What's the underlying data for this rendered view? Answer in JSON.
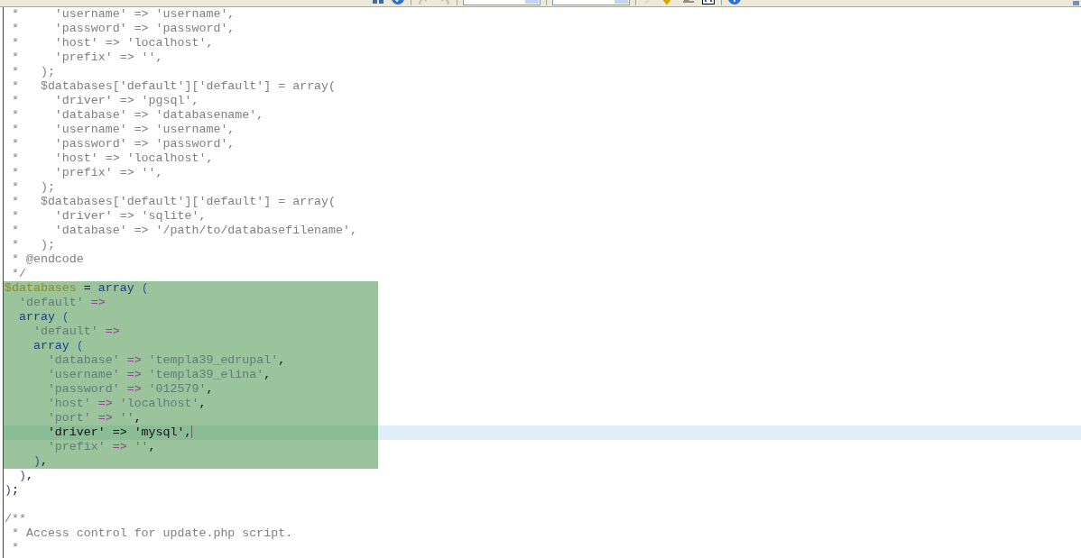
{
  "toolbar": {
    "items": [
      {
        "kind": "grid",
        "disabled": false
      },
      {
        "kind": "help",
        "disabled": false
      },
      {
        "kind": "sep"
      },
      {
        "kind": "redo",
        "disabled": true
      },
      {
        "kind": "undo",
        "disabled": true
      },
      {
        "kind": "sep"
      },
      {
        "kind": "dropdown"
      },
      {
        "kind": "sep"
      },
      {
        "kind": "dropdown"
      },
      {
        "kind": "sep"
      },
      {
        "kind": "pen",
        "disabled": true
      },
      {
        "kind": "check",
        "disabled": false
      },
      {
        "kind": "eraser",
        "disabled": false
      },
      {
        "kind": "swap",
        "disabled": false
      },
      {
        "kind": "sep"
      },
      {
        "kind": "info",
        "disabled": false
      }
    ]
  },
  "lines": [
    {
      "selected": false,
      "current": false,
      "caret": false,
      "tokens": [
        {
          "kind": "comment",
          "text": " *     'username' => 'username',"
        }
      ]
    },
    {
      "selected": false,
      "current": false,
      "caret": false,
      "tokens": [
        {
          "kind": "comment",
          "text": " *     'password' => 'password',"
        }
      ]
    },
    {
      "selected": false,
      "current": false,
      "caret": false,
      "tokens": [
        {
          "kind": "comment",
          "text": " *     'host' => 'localhost',"
        }
      ]
    },
    {
      "selected": false,
      "current": false,
      "caret": false,
      "tokens": [
        {
          "kind": "comment",
          "text": " *     'prefix' => '',"
        }
      ]
    },
    {
      "selected": false,
      "current": false,
      "caret": false,
      "tokens": [
        {
          "kind": "comment",
          "text": " *   );"
        }
      ]
    },
    {
      "selected": false,
      "current": false,
      "caret": false,
      "tokens": [
        {
          "kind": "comment",
          "text": " *   $databases['default']['default'] = array("
        }
      ]
    },
    {
      "selected": false,
      "current": false,
      "caret": false,
      "tokens": [
        {
          "kind": "comment",
          "text": " *     'driver' => 'pgsql',"
        }
      ]
    },
    {
      "selected": false,
      "current": false,
      "caret": false,
      "tokens": [
        {
          "kind": "comment",
          "text": " *     'database' => 'databasename',"
        }
      ]
    },
    {
      "selected": false,
      "current": false,
      "caret": false,
      "tokens": [
        {
          "kind": "comment",
          "text": " *     'username' => 'username',"
        }
      ]
    },
    {
      "selected": false,
      "current": false,
      "caret": false,
      "tokens": [
        {
          "kind": "comment",
          "text": " *     'password' => 'password',"
        }
      ]
    },
    {
      "selected": false,
      "current": false,
      "caret": false,
      "tokens": [
        {
          "kind": "comment",
          "text": " *     'host' => 'localhost',"
        }
      ]
    },
    {
      "selected": false,
      "current": false,
      "caret": false,
      "tokens": [
        {
          "kind": "comment",
          "text": " *     'prefix' => '',"
        }
      ]
    },
    {
      "selected": false,
      "current": false,
      "caret": false,
      "tokens": [
        {
          "kind": "comment",
          "text": " *   );"
        }
      ]
    },
    {
      "selected": false,
      "current": false,
      "caret": false,
      "tokens": [
        {
          "kind": "comment",
          "text": " *   $databases['default']['default'] = array("
        }
      ]
    },
    {
      "selected": false,
      "current": false,
      "caret": false,
      "tokens": [
        {
          "kind": "comment",
          "text": " *     'driver' => 'sqlite',"
        }
      ]
    },
    {
      "selected": false,
      "current": false,
      "caret": false,
      "tokens": [
        {
          "kind": "comment",
          "text": " *     'database' => '/path/to/databasefilename',"
        }
      ]
    },
    {
      "selected": false,
      "current": false,
      "caret": false,
      "tokens": [
        {
          "kind": "comment",
          "text": " *   );"
        }
      ]
    },
    {
      "selected": false,
      "current": false,
      "caret": false,
      "tokens": [
        {
          "kind": "comment",
          "text": " * @endcode"
        }
      ]
    },
    {
      "selected": false,
      "current": false,
      "caret": false,
      "tokens": [
        {
          "kind": "comment",
          "text": " */"
        }
      ]
    },
    {
      "selected": true,
      "current": false,
      "caret": false,
      "tokens": [
        {
          "kind": "variable",
          "text": "$databases"
        },
        {
          "kind": "plain",
          "text": " = "
        },
        {
          "kind": "keyword",
          "text": "array"
        },
        {
          "kind": "paren",
          "text": " ("
        }
      ]
    },
    {
      "selected": true,
      "current": false,
      "caret": false,
      "tokens": [
        {
          "kind": "string",
          "text": "  'default'"
        },
        {
          "kind": "operator",
          "text": " =>"
        }
      ]
    },
    {
      "selected": true,
      "current": false,
      "caret": false,
      "tokens": [
        {
          "kind": "keyword",
          "text": "  array"
        },
        {
          "kind": "paren",
          "text": " ("
        }
      ]
    },
    {
      "selected": true,
      "current": false,
      "caret": false,
      "tokens": [
        {
          "kind": "string",
          "text": "    'default'"
        },
        {
          "kind": "operator",
          "text": " =>"
        }
      ]
    },
    {
      "selected": true,
      "current": false,
      "caret": false,
      "tokens": [
        {
          "kind": "keyword",
          "text": "    array"
        },
        {
          "kind": "paren",
          "text": " ("
        }
      ]
    },
    {
      "selected": true,
      "current": false,
      "caret": false,
      "tokens": [
        {
          "kind": "string",
          "text": "      'database'"
        },
        {
          "kind": "operator",
          "text": " => "
        },
        {
          "kind": "string",
          "text": "'templa39_edrupal'"
        },
        {
          "kind": "plain",
          "text": ","
        }
      ]
    },
    {
      "selected": true,
      "current": false,
      "caret": false,
      "tokens": [
        {
          "kind": "string",
          "text": "      'username'"
        },
        {
          "kind": "operator",
          "text": " => "
        },
        {
          "kind": "string",
          "text": "'templa39_elina'"
        },
        {
          "kind": "plain",
          "text": ","
        }
      ]
    },
    {
      "selected": true,
      "current": false,
      "caret": false,
      "tokens": [
        {
          "kind": "string",
          "text": "      'password'"
        },
        {
          "kind": "operator",
          "text": " => "
        },
        {
          "kind": "string",
          "text": "'012579'"
        },
        {
          "kind": "plain",
          "text": ","
        }
      ]
    },
    {
      "selected": true,
      "current": false,
      "caret": false,
      "tokens": [
        {
          "kind": "string",
          "text": "      'host'"
        },
        {
          "kind": "operator",
          "text": " => "
        },
        {
          "kind": "string",
          "text": "'localhost'"
        },
        {
          "kind": "plain",
          "text": ","
        }
      ]
    },
    {
      "selected": true,
      "current": false,
      "caret": false,
      "tokens": [
        {
          "kind": "string",
          "text": "      'port'"
        },
        {
          "kind": "operator",
          "text": " => "
        },
        {
          "kind": "string",
          "text": "''"
        },
        {
          "kind": "plain",
          "text": ","
        }
      ]
    },
    {
      "selected": true,
      "current": true,
      "caret": true,
      "tokens": [
        {
          "kind": "plain",
          "text": "      'driver' => 'mysql',"
        }
      ]
    },
    {
      "selected": true,
      "current": false,
      "caret": false,
      "tokens": [
        {
          "kind": "string",
          "text": "      'prefix'"
        },
        {
          "kind": "operator",
          "text": " => "
        },
        {
          "kind": "string",
          "text": "''"
        },
        {
          "kind": "plain",
          "text": ","
        }
      ]
    },
    {
      "selected": true,
      "current": false,
      "caret": false,
      "tokens": [
        {
          "kind": "paren",
          "text": "    )"
        },
        {
          "kind": "plain",
          "text": ","
        }
      ]
    },
    {
      "selected": false,
      "current": false,
      "caret": false,
      "tokens": [
        {
          "kind": "paren",
          "text": "  )"
        },
        {
          "kind": "plain",
          "text": ","
        }
      ]
    },
    {
      "selected": false,
      "current": false,
      "caret": false,
      "tokens": [
        {
          "kind": "paren",
          "text": ")"
        },
        {
          "kind": "plain",
          "text": ";"
        }
      ]
    },
    {
      "selected": false,
      "current": false,
      "caret": false
    },
    {
      "selected": false,
      "current": false,
      "caret": false,
      "tokens": [
        {
          "kind": "comment",
          "text": "/**"
        }
      ]
    },
    {
      "selected": false,
      "current": false,
      "caret": false,
      "tokens": [
        {
          "kind": "comment",
          "text": " * Access control for update.php script."
        }
      ]
    },
    {
      "selected": false,
      "current": false,
      "caret": false,
      "tokens": [
        {
          "kind": "comment",
          "text": " *"
        }
      ]
    }
  ]
}
